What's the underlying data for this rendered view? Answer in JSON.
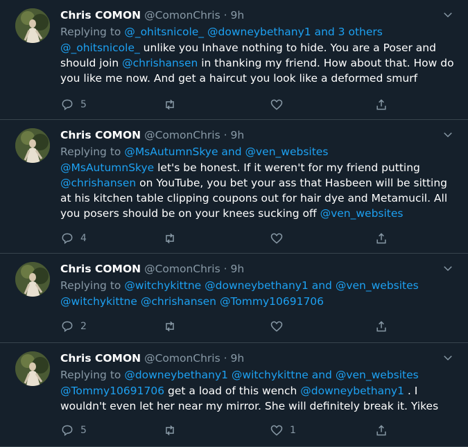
{
  "tweets": [
    {
      "name": "Chris COMON",
      "handle": "@ComonChris",
      "time": "· 9h",
      "replying": [
        {
          "t": "Replying to ",
          "c": "g"
        },
        {
          "t": "@_ohitsnicole_",
          "c": "l"
        },
        {
          "t": " ",
          "c": "g"
        },
        {
          "t": "@downeybethany1",
          "c": "l"
        },
        {
          "t": " and 3 others",
          "c": "l"
        }
      ],
      "body": [
        {
          "t": "@_ohitsnicole_",
          "c": "l"
        },
        {
          "t": "  unlike you Inhave nothing to hide. You are a Poser and should join ",
          "c": "w"
        },
        {
          "t": "@chrishansen",
          "c": "l"
        },
        {
          "t": " in thanking my friend. How about that. How do you like me now. And get a haircut you look like a deformed smurf",
          "c": "w"
        }
      ],
      "counts": {
        "reply": "5",
        "retweet": "",
        "like": ""
      }
    },
    {
      "name": "Chris COMON",
      "handle": "@ComonChris",
      "time": "· 9h",
      "replying": [
        {
          "t": "Replying to ",
          "c": "g"
        },
        {
          "t": "@MsAutumnSkye",
          "c": "l"
        },
        {
          "t": " and ",
          "c": "l"
        },
        {
          "t": "@ven_websites",
          "c": "l"
        }
      ],
      "body": [
        {
          "t": "@MsAutumnSkye",
          "c": "l"
        },
        {
          "t": " let's be honest. If it weren't for my friend putting ",
          "c": "w"
        },
        {
          "t": "@chrishansen",
          "c": "l"
        },
        {
          "t": " on YouTube, you bet your ass that Hasbeen will be sitting at his kitchen table clipping coupons out for hair dye and Metamucil. All you posers  should be on your knees sucking off ",
          "c": "w"
        },
        {
          "t": "@ven_websites",
          "c": "l"
        }
      ],
      "counts": {
        "reply": "4",
        "retweet": "",
        "like": ""
      }
    },
    {
      "name": "Chris COMON",
      "handle": "@ComonChris",
      "time": "· 9h",
      "replying": [
        {
          "t": "Replying to ",
          "c": "g"
        },
        {
          "t": "@witchykittne",
          "c": "l"
        },
        {
          "t": " ",
          "c": "g"
        },
        {
          "t": "@downeybethany1",
          "c": "l"
        },
        {
          "t": " and ",
          "c": "l"
        },
        {
          "t": "@ven_websites",
          "c": "l"
        }
      ],
      "body": [
        {
          "t": "@witchykittne",
          "c": "l"
        },
        {
          "t": " ",
          "c": "w"
        },
        {
          "t": "@chrishansen",
          "c": "l"
        },
        {
          "t": " ",
          "c": "w"
        },
        {
          "t": "@Tommy10691706",
          "c": "l"
        }
      ],
      "counts": {
        "reply": "2",
        "retweet": "",
        "like": ""
      }
    },
    {
      "name": "Chris COMON",
      "handle": "@ComonChris",
      "time": "· 9h",
      "replying": [
        {
          "t": "Replying to ",
          "c": "g"
        },
        {
          "t": "@downeybethany1",
          "c": "l"
        },
        {
          "t": " ",
          "c": "g"
        },
        {
          "t": "@witchykittne",
          "c": "l"
        },
        {
          "t": " and ",
          "c": "l"
        },
        {
          "t": "@ven_websites",
          "c": "l"
        }
      ],
      "body": [
        {
          "t": "@Tommy10691706",
          "c": "l"
        },
        {
          "t": " get a load of this wench ",
          "c": "w"
        },
        {
          "t": "@downeybethany1",
          "c": "l"
        },
        {
          "t": " . I wouldn't even let her near my mirror. She will definitely break it. Yikes",
          "c": "w"
        }
      ],
      "counts": {
        "reply": "5",
        "retweet": "",
        "like": "1"
      }
    }
  ],
  "icons": {
    "reply": "reply-icon",
    "retweet": "retweet-icon",
    "like": "heart-icon",
    "share": "share-icon",
    "more": "chevron-down-icon"
  },
  "colors": {
    "background": "#15202b",
    "link": "#1da1f2",
    "muted": "#8899a6",
    "divider": "#38444d"
  }
}
